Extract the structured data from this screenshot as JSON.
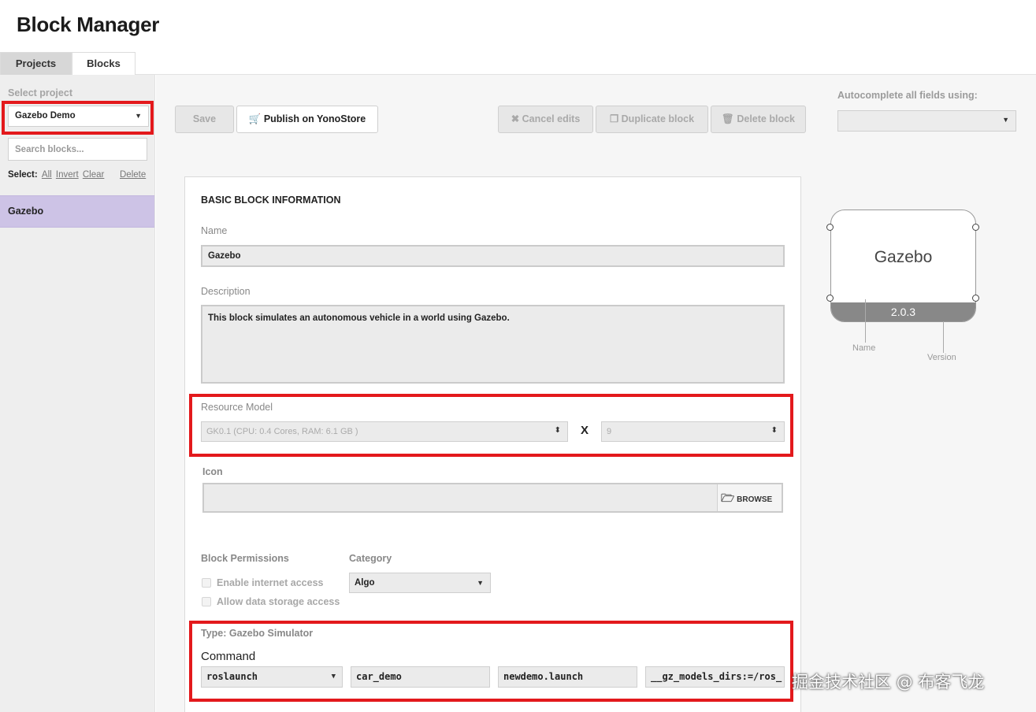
{
  "app": {
    "title": "Block Manager"
  },
  "tabs": [
    {
      "label": "Projects"
    },
    {
      "label": "Blocks"
    }
  ],
  "sidebar": {
    "select_project_label": "Select project",
    "project_value": "Gazebo Demo",
    "search_placeholder": "Search blocks...",
    "select_label": "Select:",
    "links": {
      "all": "All",
      "invert": "Invert",
      "clear": "Clear",
      "delete": "Delete"
    },
    "blocks": [
      {
        "label": "Gazebo"
      }
    ]
  },
  "toolbar": {
    "save": "Save",
    "publish": "Publish on YonoStore",
    "cancel": "Cancel edits",
    "duplicate": "Duplicate block",
    "delete": "Delete block"
  },
  "autocomplete": {
    "label": "Autocomplete all fields using:",
    "value": ""
  },
  "form": {
    "section_title": "BASIC BLOCK INFORMATION",
    "name_label": "Name",
    "name_value": "Gazebo",
    "description_label": "Description",
    "description_value": "This block simulates an autonomous vehicle in a world using Gazebo.",
    "resource_label": "Resource Model",
    "resource_value": "GK0.1 (CPU: 0.4 Cores, RAM: 6.1 GB )",
    "multiplier_symbol": "X",
    "count_value": "9",
    "icon_label": "Icon",
    "browse_label": "BROWSE",
    "permissions_label": "Block Permissions",
    "perm_internet": "Enable internet access",
    "perm_storage": "Allow data storage access",
    "category_label": "Category",
    "category_value": "Algo",
    "type_label": "Type: Gazebo Simulator",
    "command_label": "Command",
    "command_parts": [
      "roslaunch",
      "car_demo",
      "newdemo.launch",
      "__gz_models_dirs:=/ros_"
    ]
  },
  "diagram": {
    "name": "Gazebo",
    "version": "2.0.3",
    "name_caption": "Name",
    "version_caption": "Version"
  },
  "watermark": "掘金技术社区 @ 布客飞龙"
}
